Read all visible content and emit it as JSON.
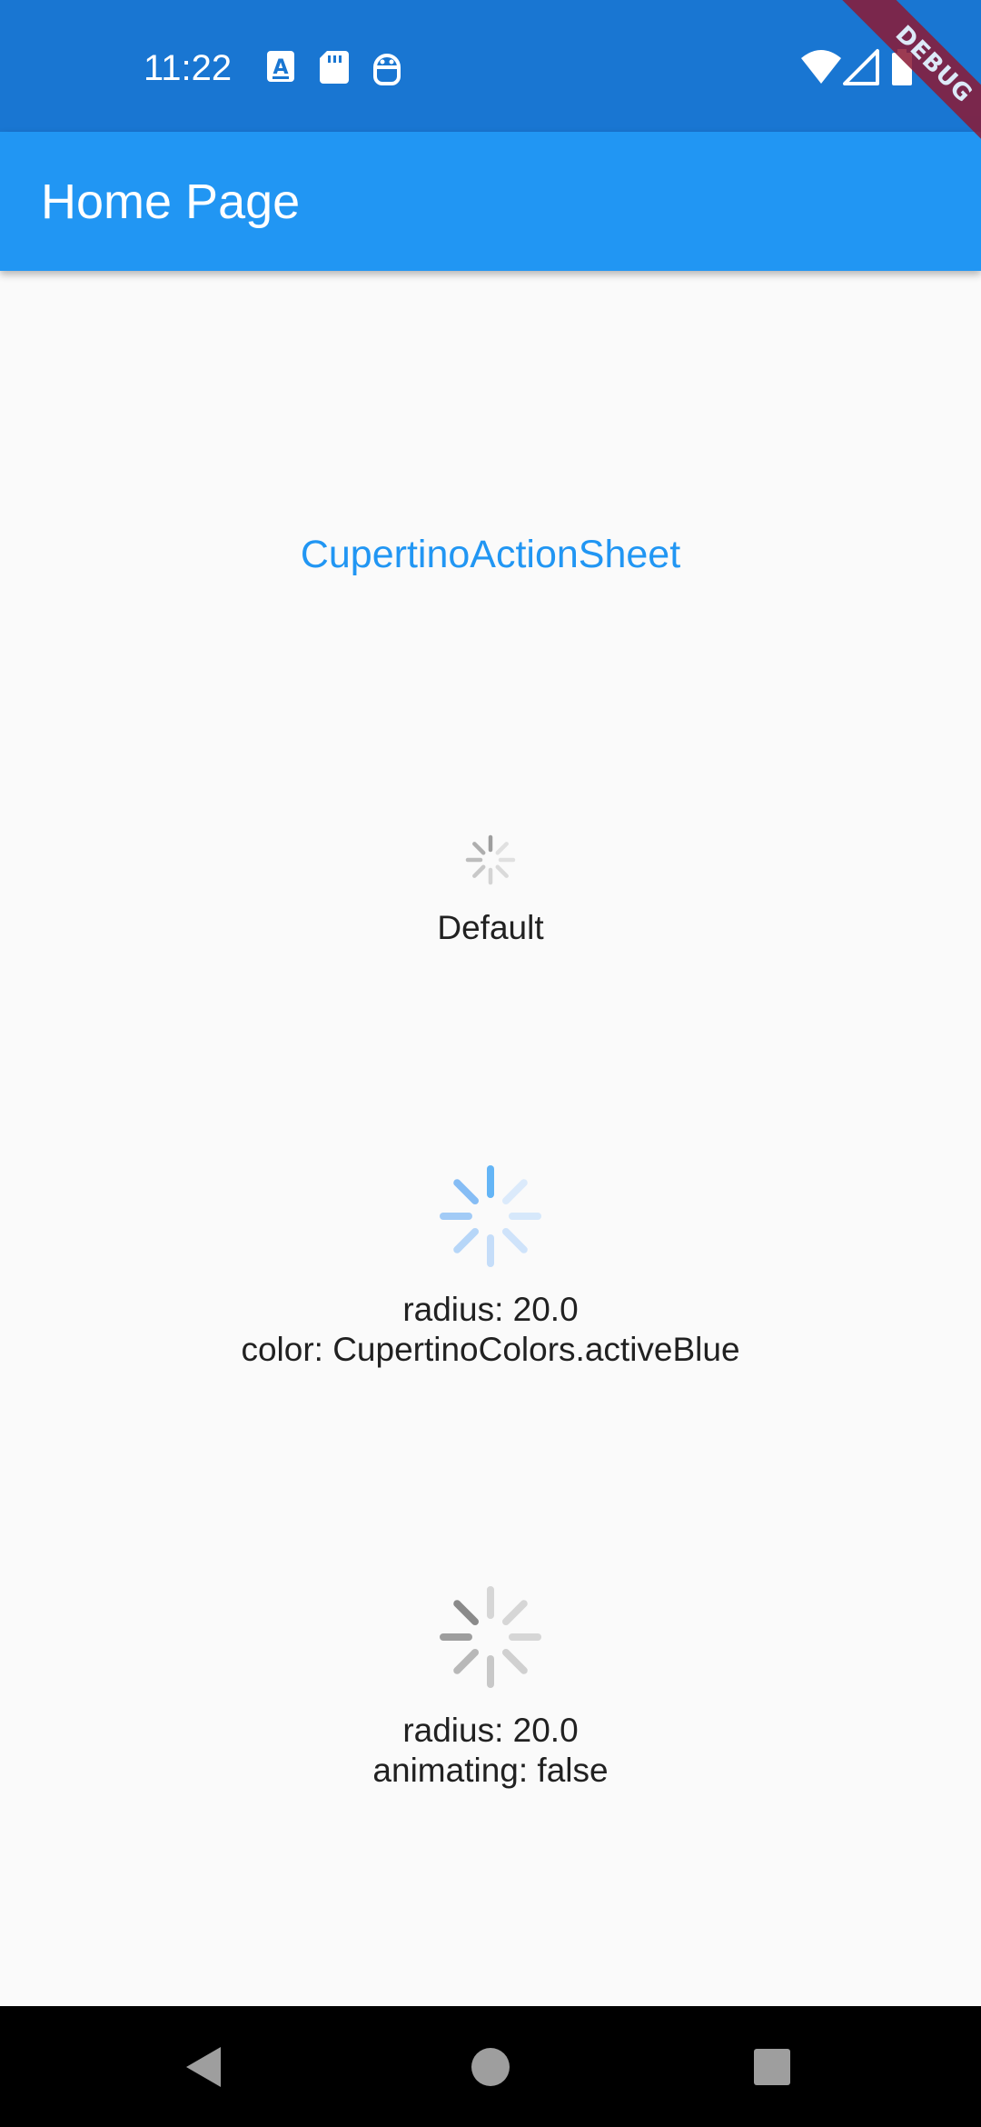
{
  "status_bar": {
    "time": "11:22",
    "background": "#1976d2",
    "left_icons": [
      "accessibility-a-icon",
      "sd-card-icon",
      "robot-icon"
    ],
    "right_icons": [
      "wifi-icon",
      "cell-signal-icon",
      "battery-icon"
    ]
  },
  "debug_banner": {
    "label": "DEBUG"
  },
  "app_bar": {
    "title": "Home Page",
    "background": "#2196f3"
  },
  "main": {
    "action_sheet_button": "CupertinoActionSheet",
    "indicators": [
      {
        "icon": "activity-indicator-icon",
        "caption_lines": [
          "Default"
        ],
        "color": "#9e9e9e"
      },
      {
        "icon": "activity-indicator-icon",
        "caption_lines": [
          "radius: 20.0",
          "color: CupertinoColors.activeBlue"
        ],
        "color": "#90caf9"
      },
      {
        "icon": "activity-indicator-icon",
        "caption_lines": [
          "radius: 20.0",
          "animating: false"
        ],
        "color": "#9e9e9e"
      }
    ]
  },
  "nav_bar": {
    "buttons": [
      "back-icon",
      "home-icon",
      "recents-icon"
    ]
  }
}
